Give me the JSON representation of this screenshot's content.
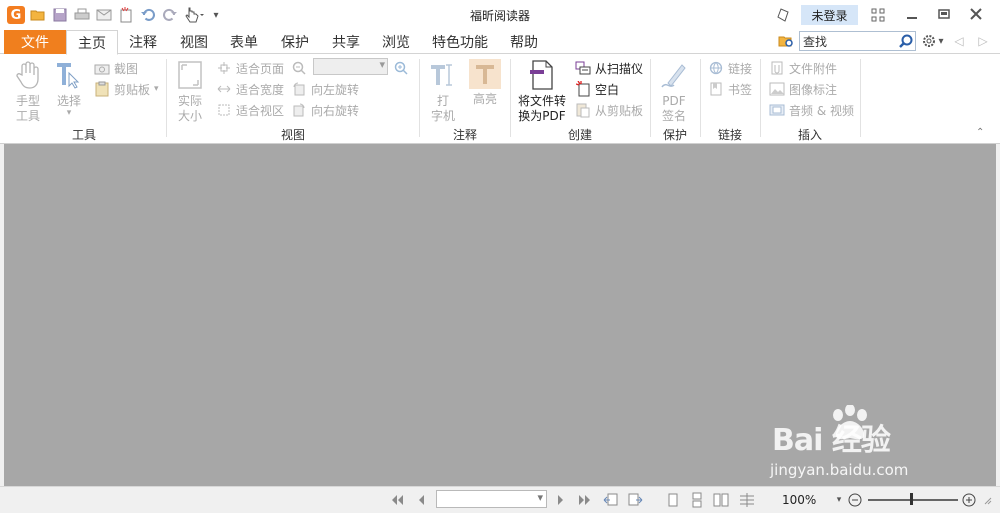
{
  "titlebar": {
    "title": "福昕阅读器",
    "login_label": "未登录"
  },
  "tabs": [
    {
      "label": "文件"
    },
    {
      "label": "主页"
    },
    {
      "label": "注释"
    },
    {
      "label": "视图"
    },
    {
      "label": "表单"
    },
    {
      "label": "保护"
    },
    {
      "label": "共享"
    },
    {
      "label": "浏览"
    },
    {
      "label": "特色功能"
    },
    {
      "label": "帮助"
    }
  ],
  "search": {
    "value": "查找"
  },
  "ribbon": {
    "tools": {
      "label": "工具",
      "hand": "手型\n工具",
      "select": "选择",
      "screenshot": "截图",
      "clipboard": "剪贴板"
    },
    "view": {
      "label": "视图",
      "actual_size": "实际\n大小",
      "fit_page": "适合页面",
      "fit_width": "适合宽度",
      "fit_visible": "适合视区",
      "rotate_left": "向左旋转",
      "rotate_right": "向右旋转"
    },
    "annotate": {
      "label": "注释",
      "typewriter": "打\n字机",
      "highlight": "高亮"
    },
    "create": {
      "label": "创建",
      "convert": "将文件转\n换为PDF",
      "from_scanner": "从扫描仪",
      "blank": "空白",
      "from_clipboard": "从剪贴板"
    },
    "protect": {
      "label": "保护",
      "pdf_sign": "PDF\n签名"
    },
    "links": {
      "label": "链接",
      "link": "链接",
      "bookmark": "书签"
    },
    "insert": {
      "label": "插入",
      "attachment": "文件附件",
      "image_annotation": "图像标注",
      "audio_video": "音频 & 视频"
    }
  },
  "statusbar": {
    "zoom": "100%"
  },
  "watermark": {
    "brand": "Bai 经验",
    "url": "jingyan.baidu.com"
  },
  "colors": {
    "file_tab": "#f07f1e",
    "doc_bg": "#a7a7a7",
    "login_bg": "#d6e6f8"
  }
}
